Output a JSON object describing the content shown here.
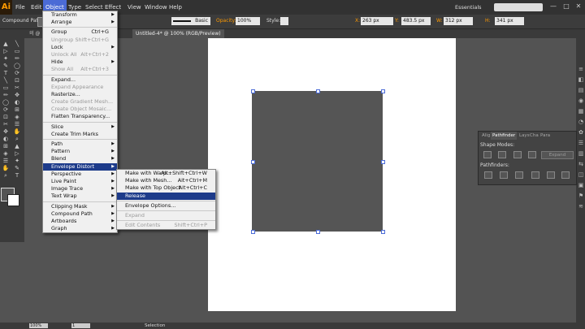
{
  "app": {
    "logo": "Ai",
    "workspace": "Essentials"
  },
  "menubar": [
    "File",
    "Edit",
    "Object",
    "Type",
    "Select",
    "Effect",
    "View",
    "Window",
    "Help"
  ],
  "window_buttons": [
    "—",
    "□",
    "✕"
  ],
  "control_bar": {
    "selection_label": "Compound Path",
    "stroke_style": "Basic",
    "opacity_label": "Opacity:",
    "opacity_value": "100%",
    "style_label": "Style:",
    "x_label": "X:",
    "x_value": "263 px",
    "y_label": "Y:",
    "y_value": "483.5 px",
    "w_label": "W:",
    "w_value": "312 px",
    "h_label": "H:",
    "h_value": "341 px"
  },
  "tabs": [
    {
      "label": "의 @ 150% (RGB/Preview)"
    },
    {
      "label": "Untitled-4* @ 100% (RGB/Preview)"
    }
  ],
  "object_menu": [
    {
      "label": "Transform",
      "arrow": true
    },
    {
      "label": "Arrange",
      "arrow": true
    },
    {
      "sep": true
    },
    {
      "label": "Group",
      "shortcut": "Ctrl+G"
    },
    {
      "label": "Ungroup",
      "shortcut": "Shift+Ctrl+G",
      "disabled": true
    },
    {
      "label": "Lock",
      "arrow": true
    },
    {
      "label": "Unlock All",
      "shortcut": "Alt+Ctrl+2",
      "disabled": true
    },
    {
      "label": "Hide",
      "arrow": true
    },
    {
      "label": "Show All",
      "shortcut": "Alt+Ctrl+3",
      "disabled": true
    },
    {
      "sep": true
    },
    {
      "label": "Expand..."
    },
    {
      "label": "Expand Appearance",
      "disabled": true
    },
    {
      "label": "Rasterize..."
    },
    {
      "label": "Create Gradient Mesh...",
      "disabled": true
    },
    {
      "label": "Create Object Mosaic...",
      "disabled": true
    },
    {
      "label": "Flatten Transparency..."
    },
    {
      "sep": true
    },
    {
      "label": "Slice",
      "arrow": true
    },
    {
      "label": "Create Trim Marks"
    },
    {
      "sep": true
    },
    {
      "label": "Path",
      "arrow": true
    },
    {
      "label": "Pattern",
      "arrow": true
    },
    {
      "label": "Blend",
      "arrow": true
    },
    {
      "label": "Envelope Distort",
      "arrow": true,
      "highlight": true
    },
    {
      "label": "Perspective",
      "arrow": true
    },
    {
      "label": "Live Paint",
      "arrow": true
    },
    {
      "label": "Image Trace",
      "arrow": true
    },
    {
      "label": "Text Wrap",
      "arrow": true
    },
    {
      "sep": true
    },
    {
      "label": "Clipping Mask",
      "arrow": true
    },
    {
      "label": "Compound Path",
      "arrow": true
    },
    {
      "label": "Artboards",
      "arrow": true
    },
    {
      "label": "Graph",
      "arrow": true
    }
  ],
  "envelope_submenu": [
    {
      "label": "Make with Warp...",
      "shortcut": "Alt+Shift+Ctrl+W"
    },
    {
      "label": "Make with Mesh...",
      "shortcut": "Alt+Ctrl+M"
    },
    {
      "label": "Make with Top Object",
      "shortcut": "Alt+Ctrl+C"
    },
    {
      "label": "Release",
      "disabled": true,
      "highlight": true
    },
    {
      "sep": true
    },
    {
      "label": "Envelope Options..."
    },
    {
      "sep": true
    },
    {
      "label": "Expand",
      "disabled": true
    },
    {
      "sep": true
    },
    {
      "label": "Edit Contents",
      "shortcut": "Shift+Ctrl+P",
      "disabled": true
    }
  ],
  "pathfinder_panel": {
    "tabs": [
      "Alig",
      "Pathfinder",
      "Lays",
      "Cha",
      "Para"
    ],
    "shape_modes_label": "Shape Modes:",
    "expand_label": "Expand",
    "pathfinders_label": "Pathfinders:"
  },
  "status_bar": {
    "zoom": "100%",
    "page": "1",
    "tool": "Selection"
  },
  "colors": {
    "highlight": "#1d3b8a",
    "menubar_active": "#4b6bd6",
    "accent": "#ff9a00",
    "shape_fill": "#555555"
  }
}
